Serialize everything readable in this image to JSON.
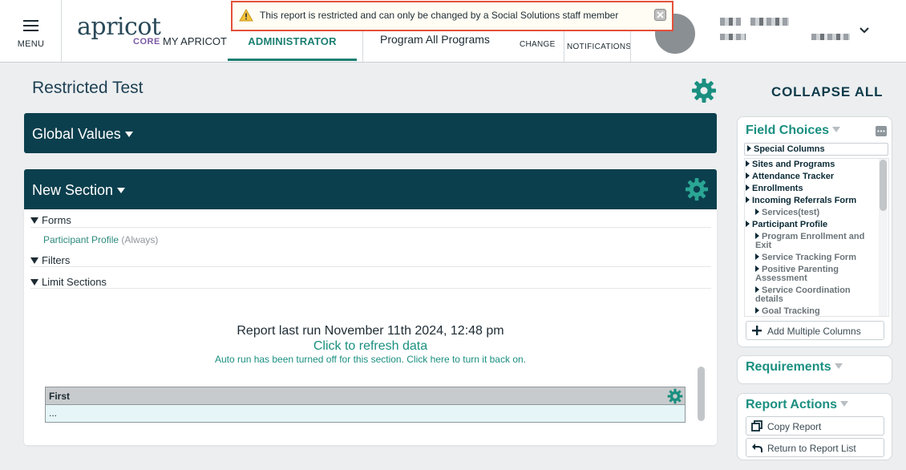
{
  "header": {
    "menu_label": "MENU",
    "logo_text": "apricot",
    "logo_sub": "CORE",
    "my_apricot": "MY APRICOT",
    "admin_tab": "ADMINISTRATOR",
    "program": "Program All Programs",
    "change": "CHANGE",
    "notifications": "NOTIFICATIONS"
  },
  "banner": {
    "message": "This report is restricted and can only be changed by a Social Solutions staff member",
    "color": "#e4503a"
  },
  "page": {
    "title": "Restricted Test",
    "collapse_all": "COLLAPSE ALL"
  },
  "global_values": {
    "label": "Global Values"
  },
  "new_section": {
    "label": "New Section",
    "forms_label": "Forms",
    "form_link": "Participant Profile",
    "form_qualifier": "(Always)",
    "filters_label": "Filters",
    "limit_label": "Limit Sections",
    "last_run": "Report last run November 11th 2024, 12:48 pm",
    "refresh": "Click to refresh data",
    "autorun": "Auto run has been turned off for this section. Click here to turn it back on.",
    "table": {
      "column": "First",
      "cell": "..."
    }
  },
  "field_choices": {
    "title": "Field Choices",
    "special_columns": "Special Columns",
    "items": [
      {
        "label": "Sites and Programs",
        "sub": false
      },
      {
        "label": "Attendance Tracker",
        "sub": false
      },
      {
        "label": "Enrollments",
        "sub": false
      },
      {
        "label": "Incoming Referrals Form",
        "sub": false
      },
      {
        "label": "Services(test)",
        "sub": true
      },
      {
        "label": "Participant Profile",
        "sub": false
      },
      {
        "label": "Program Enrollment and Exit",
        "sub": true
      },
      {
        "label": "Service Tracking Form",
        "sub": true
      },
      {
        "label": "Positive Parenting Assessment",
        "sub": true
      },
      {
        "label": "Service Coordination details",
        "sub": true
      },
      {
        "label": "Goal Tracking",
        "sub": true
      }
    ],
    "add_multiple": "Add Multiple Columns"
  },
  "requirements": {
    "title": "Requirements"
  },
  "report_actions": {
    "title": "Report Actions",
    "copy": "Copy Report",
    "return": "Return to Report List"
  },
  "colors": {
    "accent": "#1a8f80",
    "bar": "#0b3f4d"
  }
}
